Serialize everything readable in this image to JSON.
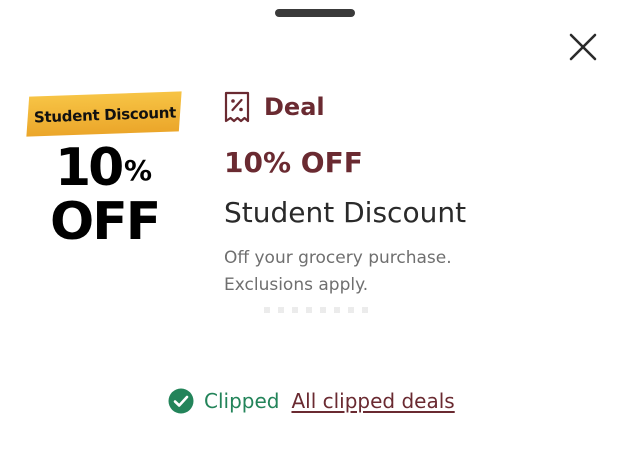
{
  "offer_image": {
    "banner_text": "Student Discount",
    "percent_number": "10",
    "percent_sign": "%",
    "off_text": "OFF"
  },
  "deal": {
    "type_icon": "coupon-icon",
    "type_label": "Deal",
    "value": "10% OFF",
    "title": "Student Discount",
    "description": "Off your grocery purchase. Exclusions apply."
  },
  "actions": {
    "close_icon": "close-icon",
    "check_icon": "check-circle-icon",
    "clipped_status": "Clipped",
    "all_clipped_link": "All clipped deals"
  },
  "colors": {
    "brand_maroon": "#6a2a31",
    "clipped_green": "#23845a",
    "banner_yellow": "#f3b93a"
  }
}
